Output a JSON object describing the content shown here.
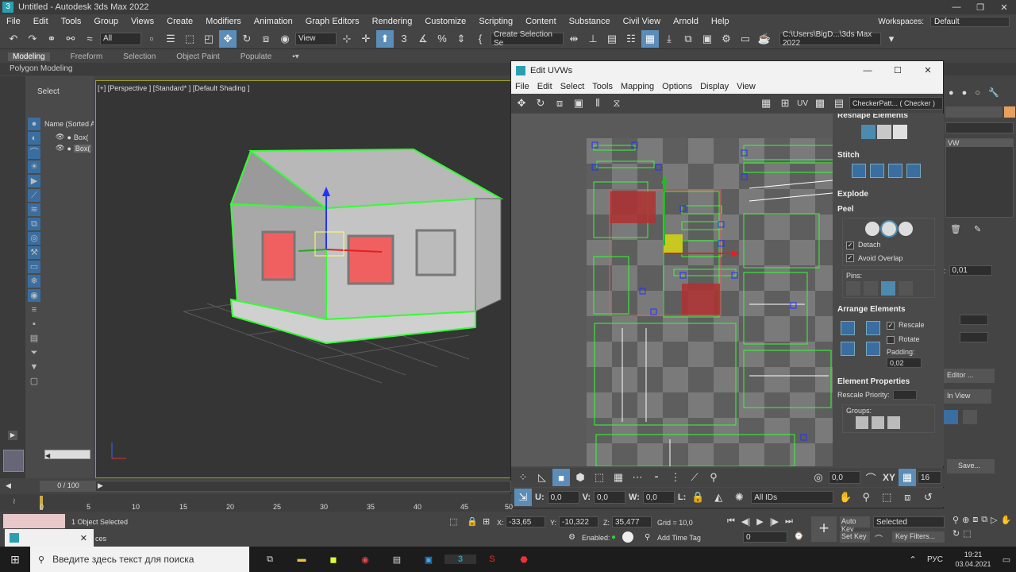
{
  "title_bar": {
    "title": "Untitled - Autodesk 3ds Max 2022"
  },
  "menu": [
    "File",
    "Edit",
    "Tools",
    "Group",
    "Views",
    "Create",
    "Modifiers",
    "Animation",
    "Graph Editors",
    "Rendering",
    "Customize",
    "Scripting",
    "Content",
    "Substance",
    "Civil View",
    "Arnold",
    "Help"
  ],
  "workspaces": {
    "label": "Workspaces:",
    "value": "Default"
  },
  "toolbar": {
    "filter": "All",
    "view": "View",
    "selection_set": "Create Selection Se",
    "path": "C:\\Users\\BigD...\\3ds Max 2022"
  },
  "ribbon_tabs": [
    "Modeling",
    "Freeform",
    "Selection",
    "Object Paint",
    "Populate"
  ],
  "ribbon_sub": "Polygon Modeling",
  "scene_explorer": {
    "select_label": "Select",
    "column": "Name (Sorted A",
    "items": [
      "Box(",
      "Box("
    ]
  },
  "viewport": {
    "label": "[+] [Perspective ] [Standard* ] [Default Shading ]"
  },
  "uv_editor": {
    "title": "Edit UVWs",
    "menu": [
      "File",
      "Edit",
      "Select",
      "Tools",
      "Mapping",
      "Options",
      "Display",
      "View"
    ],
    "uv_label": "UV",
    "checker": "CheckerPatt... ( Checker )",
    "sections": {
      "reshape": "Reshape Elements",
      "stitch": "Stitch",
      "explode": "Explode",
      "peel": "Peel",
      "detach": "Detach",
      "avoid_overlap": "Avoid Overlap",
      "pins": "Pins:",
      "arrange": "Arrange Elements",
      "rescale": "Rescale",
      "rotate": "Rotate",
      "padding_label": "Padding:",
      "padding_value": "0,02",
      "element_props": "Element Properties",
      "rescale_priority": "Rescale Priority:",
      "groups": "Groups:"
    },
    "bottom": {
      "value1": "0,0",
      "value2": "16",
      "u": "U:",
      "u_val": "0,0",
      "v": "V:",
      "v_val": "0,0",
      "w": "W:",
      "w_val": "0,0",
      "l": "L:",
      "ids": "All IDs",
      "xy": "XY"
    }
  },
  "right_panel": {
    "uvw": "VW",
    "value": "0,01",
    "editor": "Editor ...",
    "in_view": "In View",
    "save": "Save..."
  },
  "timeline": {
    "frame": "0 / 100",
    "ticks": [
      "0",
      "5",
      "10",
      "15",
      "20",
      "25",
      "30",
      "35",
      "40",
      "45",
      "50"
    ]
  },
  "status": {
    "selected": "1 Object Selected",
    "hint": "ces",
    "x_label": "X:",
    "x": "-33,65",
    "y_label": "Y:",
    "y": "-10,322",
    "z_label": "Z:",
    "z": "35,477",
    "grid": "Grid = 10,0",
    "enabled": "Enabled:",
    "add_time_tag": "Add Time Tag",
    "auto_key": "Auto Key",
    "set_key": "Set Key",
    "selected_dd": "Selected",
    "key_filters": "Key Filters...",
    "frame_field": "0"
  },
  "taskbar": {
    "search": "Введите здесь текст для поиска",
    "lang": "РУС",
    "time": "19:21",
    "date": "03.04.2021"
  }
}
